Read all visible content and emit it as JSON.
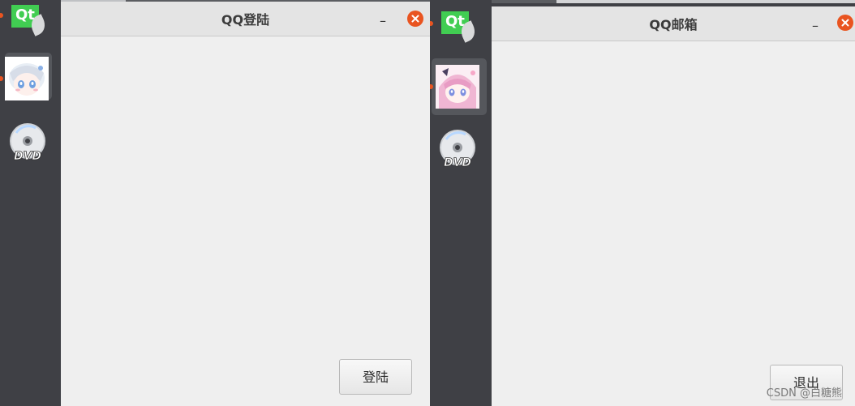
{
  "left_window": {
    "title": "QQ登陆",
    "minimize_glyph": "–",
    "close_icon": "close-icon",
    "button_label": "登陆"
  },
  "right_window": {
    "title": "QQ邮箱",
    "minimize_glyph": "–",
    "close_icon": "close-icon",
    "button_label": "退出"
  },
  "dock": {
    "items": [
      {
        "icon": "qt-creator-icon",
        "label": "Qt"
      },
      {
        "icon": "avatar-icon"
      },
      {
        "icon": "dvd-icon",
        "label": "DVD"
      }
    ]
  },
  "watermark": "CSDN @白糖熊",
  "colors": {
    "dock_bg": "#3f4045",
    "window_bg": "#efefef",
    "titlebar_bg": "#e4e4e4",
    "close_button": "#e95420",
    "qt_green": "#41cd52"
  }
}
